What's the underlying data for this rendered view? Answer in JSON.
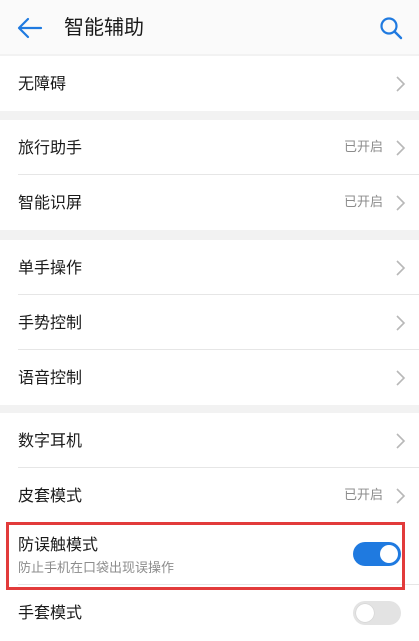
{
  "header": {
    "title": "智能辅助",
    "back_icon": "arrow-left-icon",
    "search_icon": "search-icon"
  },
  "accent_color": "#1f7ae0",
  "highlight_color": "#e23b3b",
  "groups": [
    {
      "items": [
        {
          "label": "无障碍",
          "status": ""
        }
      ]
    },
    {
      "items": [
        {
          "label": "旅行助手",
          "status": "已开启"
        },
        {
          "label": "智能识屏",
          "status": "已开启"
        }
      ]
    },
    {
      "items": [
        {
          "label": "单手操作",
          "status": ""
        },
        {
          "label": "手势控制",
          "status": ""
        },
        {
          "label": "语音控制",
          "status": ""
        }
      ]
    },
    {
      "items": [
        {
          "label": "数字耳机",
          "status": ""
        },
        {
          "label": "皮套模式",
          "status": "已开启"
        },
        {
          "label": "防误触模式",
          "subtitle": "防止手机在口袋出现误操作",
          "toggle": true
        },
        {
          "label": "手套模式",
          "toggle": false
        }
      ]
    }
  ]
}
